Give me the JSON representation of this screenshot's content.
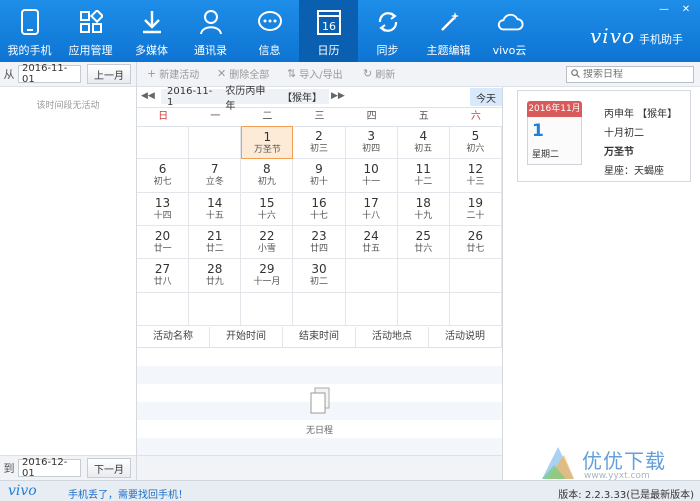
{
  "nav": {
    "items": [
      {
        "label": "我的手机",
        "icon": "phone-icon"
      },
      {
        "label": "应用管理",
        "icon": "apps-icon"
      },
      {
        "label": "多媒体",
        "icon": "download-icon"
      },
      {
        "label": "通讯录",
        "icon": "contacts-icon"
      },
      {
        "label": "信息",
        "icon": "message-icon"
      },
      {
        "label": "日历",
        "icon": "calendar-icon",
        "active": true,
        "badge": "16"
      },
      {
        "label": "同步",
        "icon": "sync-icon"
      },
      {
        "label": "主题编辑",
        "icon": "wand-icon"
      },
      {
        "label": "vivo云",
        "icon": "cloud-icon"
      }
    ],
    "brand_logo": "vivo",
    "brand_text": "手机助手"
  },
  "window": {
    "minimize": "—",
    "close": "✕"
  },
  "left_panel": {
    "from_label": "从",
    "from_date": "2016-11-01",
    "prev_month": "上一月",
    "to_label": "到",
    "to_date": "2016-12-01",
    "next_month": "下一月",
    "empty_note": "该时间段无活动"
  },
  "toolbar": {
    "new_activity": "新建活动",
    "delete_all": "删除全部",
    "import_export": "导入/导出",
    "refresh": "刷新",
    "search_placeholder": "搜索日程"
  },
  "calendar": {
    "date": "2016-11-1",
    "lunar": "农历丙申年",
    "zodiac": "【猴年】",
    "today": "今天",
    "weekdays": [
      "日",
      "一",
      "二",
      "三",
      "四",
      "五",
      "六"
    ],
    "cells": [
      {
        "d": "",
        "l": ""
      },
      {
        "d": "",
        "l": ""
      },
      {
        "d": "1",
        "l": "万圣节"
      },
      {
        "d": "2",
        "l": "初三"
      },
      {
        "d": "3",
        "l": "初四"
      },
      {
        "d": "4",
        "l": "初五"
      },
      {
        "d": "5",
        "l": "初六"
      },
      {
        "d": "6",
        "l": "初七"
      },
      {
        "d": "7",
        "l": "立冬"
      },
      {
        "d": "8",
        "l": "初九"
      },
      {
        "d": "9",
        "l": "初十"
      },
      {
        "d": "10",
        "l": "十一"
      },
      {
        "d": "11",
        "l": "十二"
      },
      {
        "d": "12",
        "l": "十三"
      },
      {
        "d": "13",
        "l": "十四"
      },
      {
        "d": "14",
        "l": "十五"
      },
      {
        "d": "15",
        "l": "十六"
      },
      {
        "d": "16",
        "l": "十七"
      },
      {
        "d": "17",
        "l": "十八"
      },
      {
        "d": "18",
        "l": "十九"
      },
      {
        "d": "19",
        "l": "二十"
      },
      {
        "d": "20",
        "l": "廿一"
      },
      {
        "d": "21",
        "l": "廿二"
      },
      {
        "d": "22",
        "l": "小雪"
      },
      {
        "d": "23",
        "l": "廿四"
      },
      {
        "d": "24",
        "l": "廿五"
      },
      {
        "d": "25",
        "l": "廿六"
      },
      {
        "d": "26",
        "l": "廿七"
      },
      {
        "d": "27",
        "l": "廿八"
      },
      {
        "d": "28",
        "l": "廿九"
      },
      {
        "d": "29",
        "l": "十一月"
      },
      {
        "d": "30",
        "l": "初二"
      },
      {
        "d": "",
        "l": ""
      },
      {
        "d": "",
        "l": ""
      },
      {
        "d": "",
        "l": ""
      },
      {
        "d": "",
        "l": ""
      },
      {
        "d": "",
        "l": ""
      },
      {
        "d": "",
        "l": ""
      },
      {
        "d": "",
        "l": ""
      },
      {
        "d": "",
        "l": ""
      },
      {
        "d": "",
        "l": ""
      },
      {
        "d": "",
        "l": ""
      }
    ],
    "selected_index": 2
  },
  "activities": {
    "columns": [
      "活动名称",
      "开始时间",
      "结束时间",
      "活动地点",
      "活动说明"
    ],
    "empty_text": "无日程"
  },
  "info_card": {
    "month_label": "2016年11月",
    "day": "1",
    "weekday": "星期二",
    "ganzhi": "丙申年 【猴年】",
    "lunar_date": "十月初二",
    "festival": "万圣节",
    "constellation": "星座：天蝎座"
  },
  "status": {
    "logo": "vivo",
    "lost_phone": "手机丢了，需要找回手机！",
    "version": "版本: 2.2.3.33(已是最新版本)"
  },
  "watermark": {
    "text": "优优下载",
    "sub": "www.yyxt.com"
  },
  "colors": {
    "accent": "#1482df",
    "active_tab": "#0a5fb0",
    "selected_cell": "#fdebd8",
    "sunday": "#d03a3a"
  }
}
